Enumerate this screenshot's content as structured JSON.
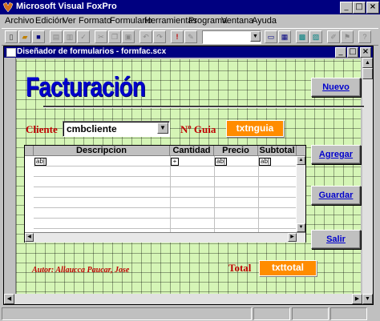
{
  "app": {
    "title": "Microsoft Visual FoxPro"
  },
  "menu": {
    "items": [
      "Archivo",
      "Edición",
      "Ver",
      "Formato",
      "Formulario",
      "Herramientas",
      "Programa",
      "Ventana",
      "Ayuda"
    ]
  },
  "form_window": {
    "title": "Diseñador de formularios - formfac.scx"
  },
  "form": {
    "heading": "Facturación",
    "cliente_label": "Cliente",
    "cliente_value": "cmbcliente",
    "guia_label": "Nº Guia",
    "guia_value": "txtnguia",
    "columns": [
      "Descripcion",
      "Cantidad",
      "Precio",
      "Subtotal"
    ],
    "total_label": "Total",
    "total_value": "txttotal",
    "author": "Autor: Allaucca Paucar, Jose",
    "buttons": {
      "nuevo": "Nuevo",
      "agregar": "Agregar",
      "guardar": "Guardar",
      "salir": "Salir"
    },
    "chips": {
      "text_col": "ab|",
      "precio_col": "ab|",
      "subtotal_col": "ab|"
    }
  },
  "colors": {
    "canvas": "#d5f5b6",
    "heading": "#0000cc",
    "orange_field": "#ff8c00",
    "label_red": "#c00000"
  }
}
